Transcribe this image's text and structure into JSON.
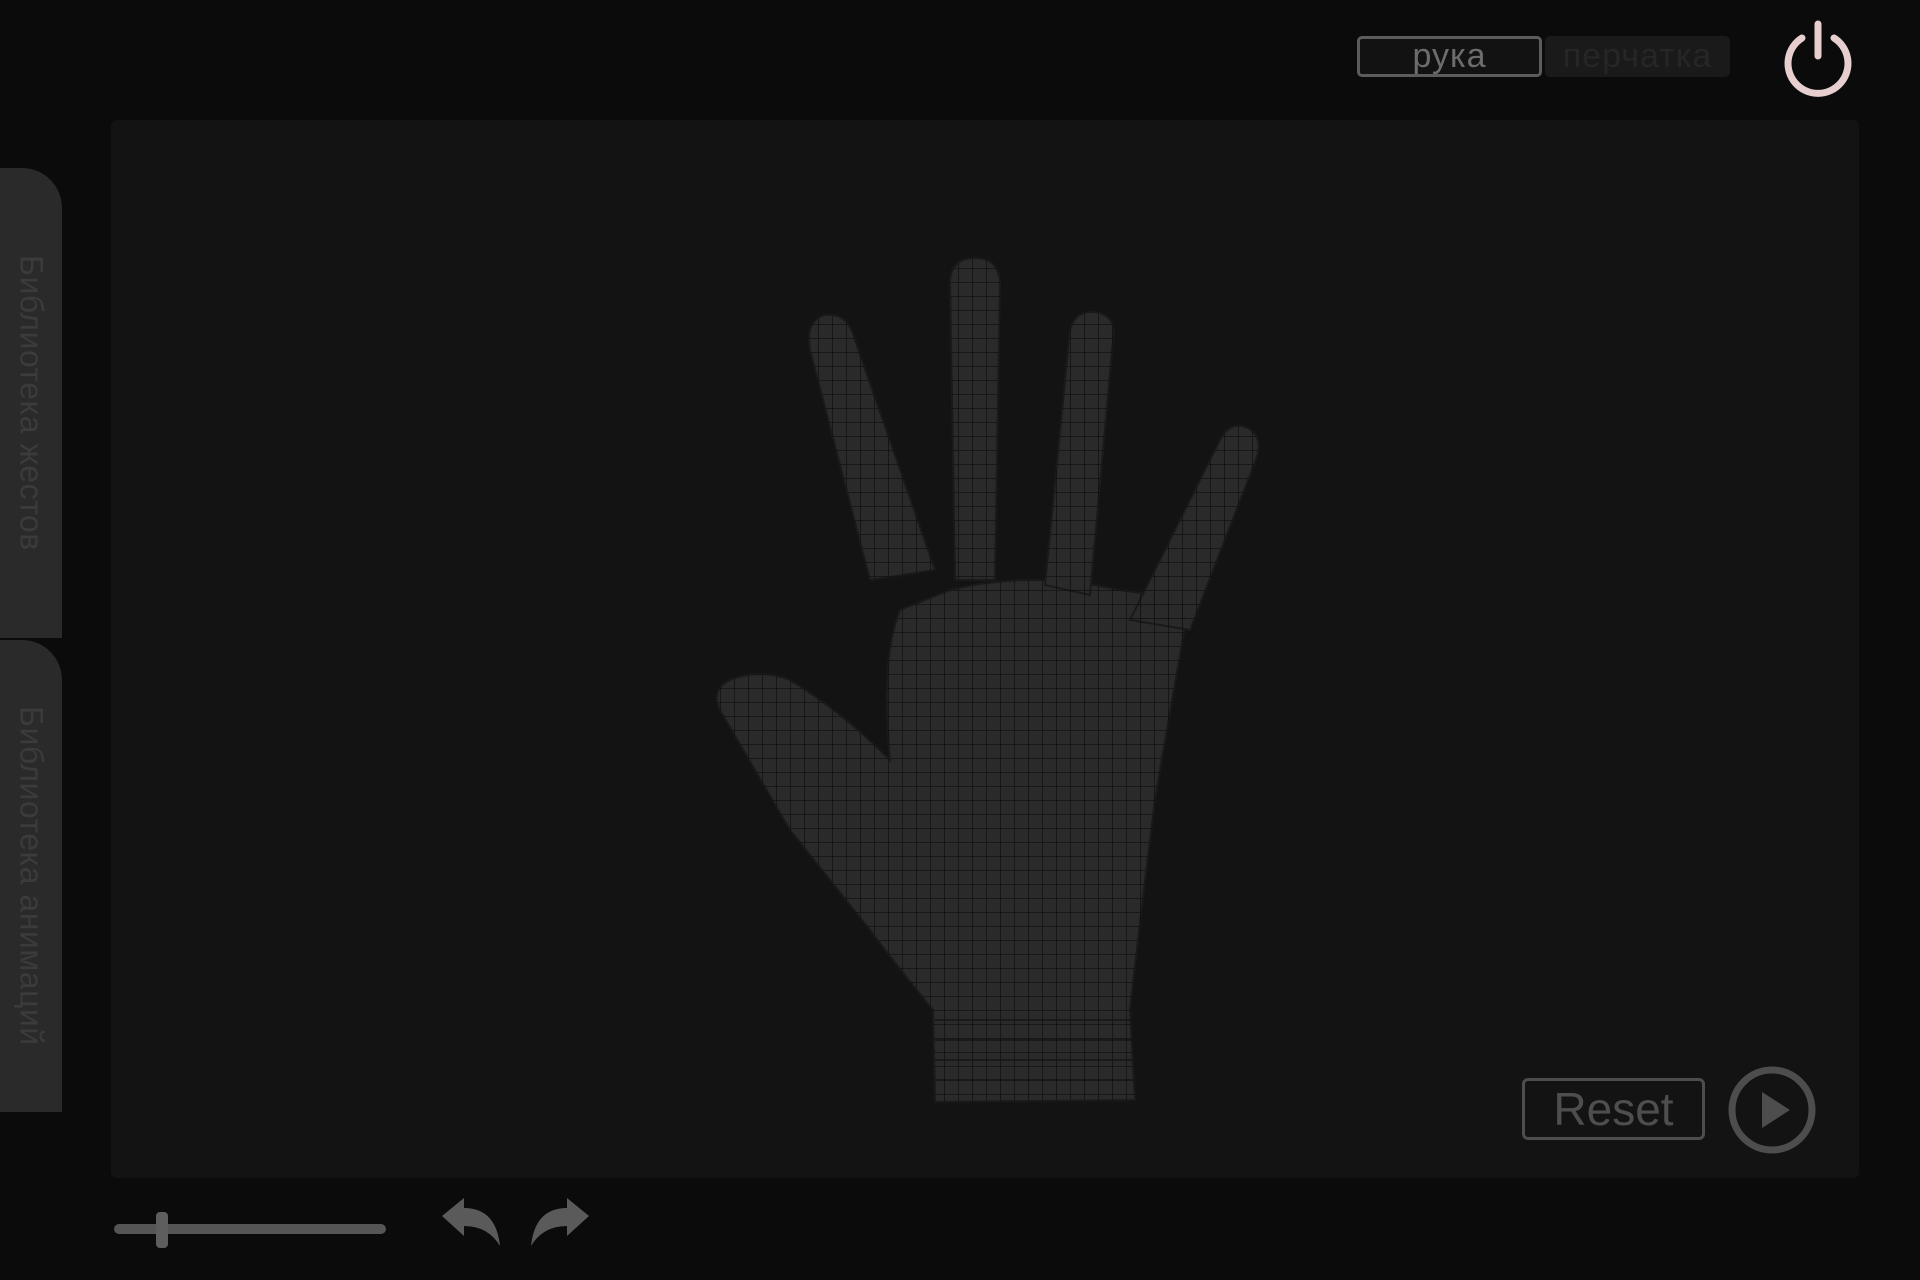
{
  "mode_toggle": {
    "hand_label": "рука",
    "glove_label": "перчатка",
    "selected": "рука"
  },
  "sidebar": {
    "gesture_library_label": "Библиотека жестов",
    "animation_library_label": "Библиотека анимаций"
  },
  "viewport": {
    "model": "hand-wireframe"
  },
  "controls": {
    "reset_label": "Reset",
    "play_icon": "play-icon",
    "undo_icon": "undo-icon",
    "redo_icon": "redo-icon",
    "power_icon": "power-icon",
    "slider_value_fraction": 0.14
  },
  "colors": {
    "power_accent": "#e8cfcf",
    "background": "#0b0b0b",
    "viewport": "#131313"
  }
}
